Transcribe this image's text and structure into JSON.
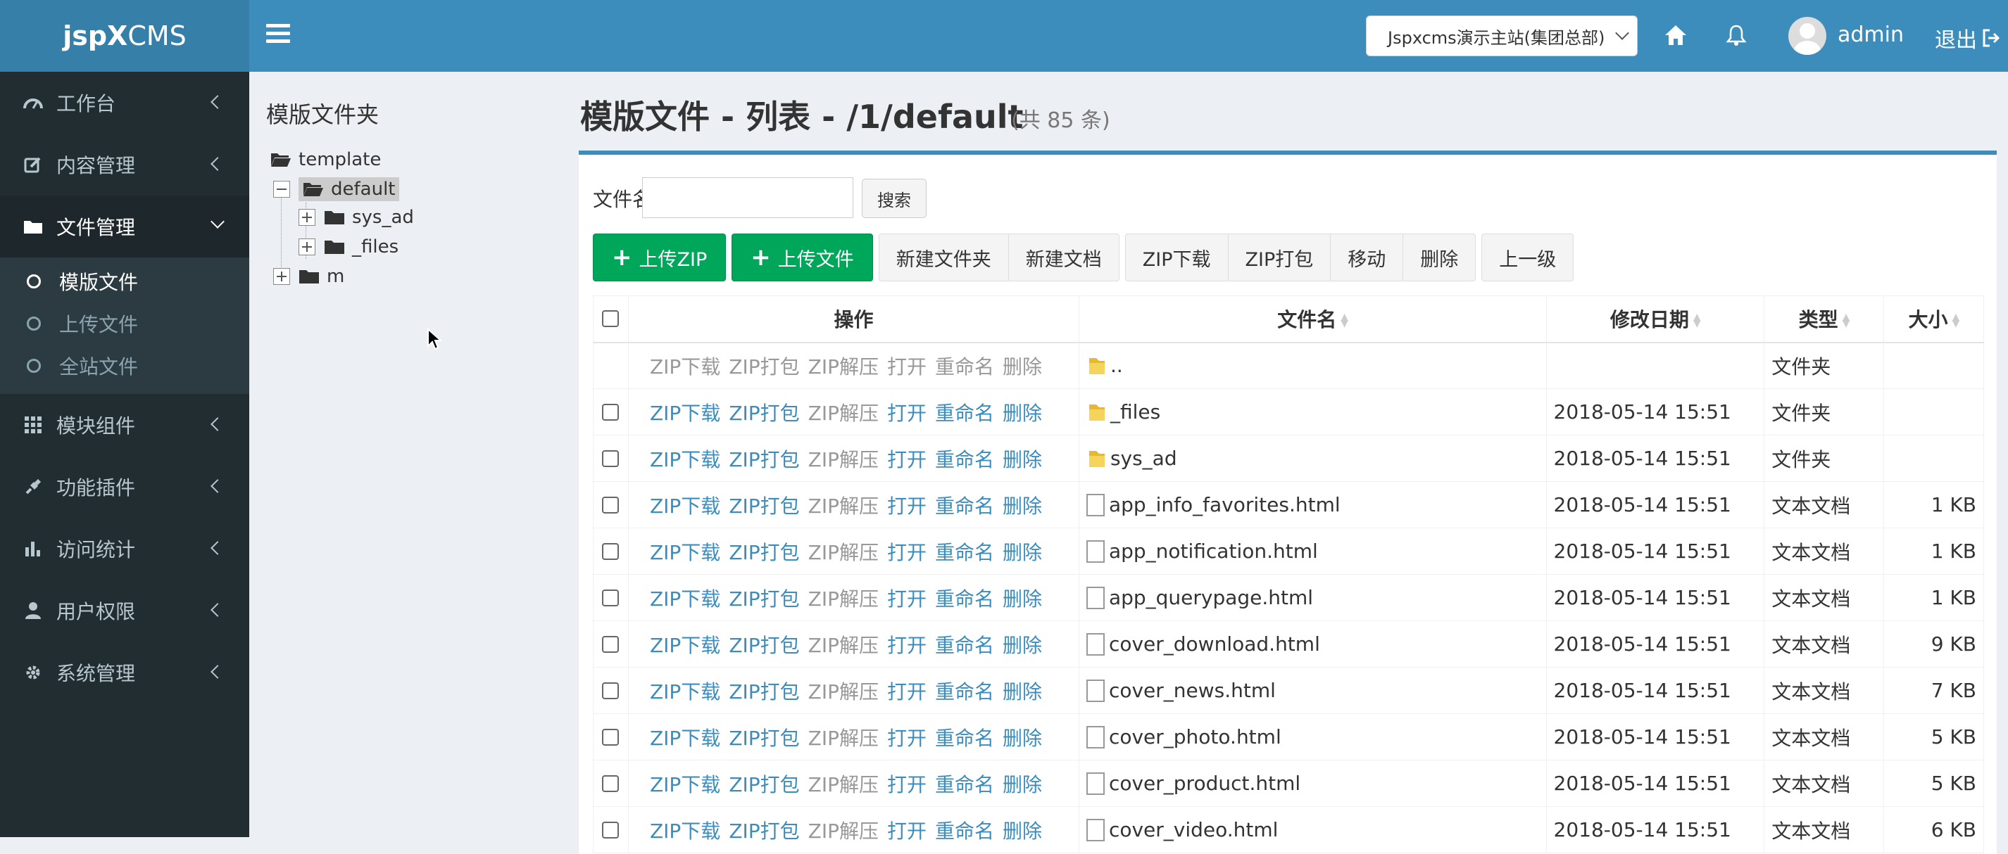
{
  "header": {
    "logo_bold": "jspX",
    "logo_rest": "CMS",
    "site_select": "Jspxcms演示主站(集团总部)",
    "username": "admin",
    "logout": "退出"
  },
  "sidebar": {
    "items": [
      {
        "label": "工作台",
        "icon": "dashboard-icon"
      },
      {
        "label": "内容管理",
        "icon": "edit-icon"
      },
      {
        "label": "文件管理",
        "icon": "folder-icon"
      },
      {
        "label": "模块组件",
        "icon": "grid-icon"
      },
      {
        "label": "功能插件",
        "icon": "plug-icon"
      },
      {
        "label": "访问统计",
        "icon": "bar-chart-icon"
      },
      {
        "label": "用户权限",
        "icon": "user-icon"
      },
      {
        "label": "系统管理",
        "icon": "cog-icon"
      }
    ],
    "subitems": [
      "模版文件",
      "上传文件",
      "全站文件"
    ]
  },
  "tree": {
    "title": "模版文件夹",
    "nodes": [
      "template",
      "default",
      "sys_ad",
      "_files",
      "m"
    ]
  },
  "main": {
    "title": "模版文件 - 列表 - /1/default",
    "count": "(共 85 条)",
    "search_label": "文件名",
    "search_value": "",
    "search_button": "搜索",
    "buttons": {
      "upload_zip": "上传ZIP",
      "upload_file": "上传文件",
      "new_folder": "新建文件夹",
      "new_doc": "新建文档",
      "zip_download": "ZIP下载",
      "zip_pack": "ZIP打包",
      "move": "移动",
      "delete": "删除",
      "up": "上一级"
    },
    "columns": {
      "ops": "操作",
      "name": "文件名",
      "date": "修改日期",
      "type": "类型",
      "size": "大小"
    },
    "op_labels": [
      "ZIP下载",
      "ZIP打包",
      "ZIP解压",
      "打开",
      "重命名",
      "删除"
    ],
    "rows": [
      {
        "name": "..",
        "date": "",
        "type": "文件夹",
        "size": "",
        "kind": "folder"
      },
      {
        "name": "_files",
        "date": "2018-05-14 15:51",
        "type": "文件夹",
        "size": "",
        "kind": "folder"
      },
      {
        "name": "sys_ad",
        "date": "2018-05-14 15:51",
        "type": "文件夹",
        "size": "",
        "kind": "folder"
      },
      {
        "name": "app_info_favorites.html",
        "date": "2018-05-14 15:51",
        "type": "文本文档",
        "size": "1 KB",
        "kind": "doc"
      },
      {
        "name": "app_notification.html",
        "date": "2018-05-14 15:51",
        "type": "文本文档",
        "size": "1 KB",
        "kind": "doc"
      },
      {
        "name": "app_querypage.html",
        "date": "2018-05-14 15:51",
        "type": "文本文档",
        "size": "1 KB",
        "kind": "doc"
      },
      {
        "name": "cover_download.html",
        "date": "2018-05-14 15:51",
        "type": "文本文档",
        "size": "9 KB",
        "kind": "doc"
      },
      {
        "name": "cover_news.html",
        "date": "2018-05-14 15:51",
        "type": "文本文档",
        "size": "7 KB",
        "kind": "doc"
      },
      {
        "name": "cover_photo.html",
        "date": "2018-05-14 15:51",
        "type": "文本文档",
        "size": "5 KB",
        "kind": "doc"
      },
      {
        "name": "cover_product.html",
        "date": "2018-05-14 15:51",
        "type": "文本文档",
        "size": "5 KB",
        "kind": "doc"
      },
      {
        "name": "cover_video.html",
        "date": "2018-05-14 15:51",
        "type": "文本文档",
        "size": "6 KB",
        "kind": "doc"
      }
    ]
  },
  "colors": {
    "header": "#3c8dbc",
    "sidebar": "#222d32",
    "green": "#00a65a",
    "link": "#3c8dbc"
  }
}
